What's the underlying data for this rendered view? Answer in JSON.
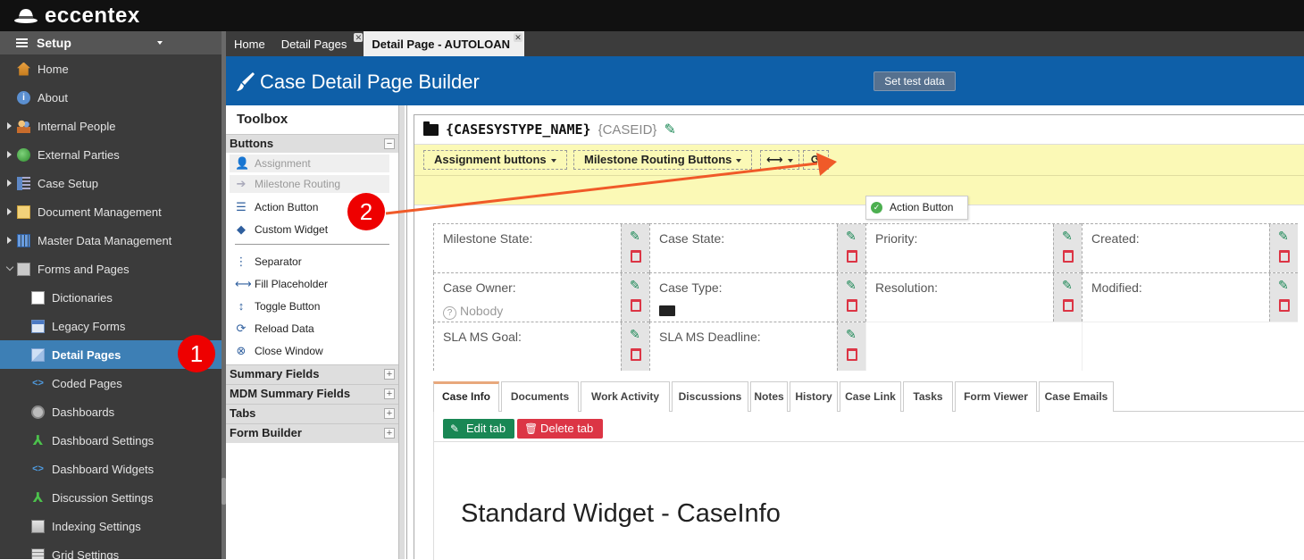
{
  "brand": {
    "name": "eccentex"
  },
  "sidebar": {
    "header": "Setup",
    "items": [
      {
        "label": "Home",
        "icon": "home-icon",
        "level": 1,
        "expander": "none"
      },
      {
        "label": "About",
        "icon": "info-icon",
        "level": 1,
        "expander": "none"
      },
      {
        "label": "Internal People",
        "icon": "people-icon",
        "level": 1,
        "expander": "closed"
      },
      {
        "label": "External Parties",
        "icon": "globe-icon",
        "level": 1,
        "expander": "closed"
      },
      {
        "label": "Case Setup",
        "icon": "case-setup-icon",
        "level": 1,
        "expander": "closed"
      },
      {
        "label": "Document Management",
        "icon": "document-icon",
        "level": 1,
        "expander": "closed"
      },
      {
        "label": "Master Data Management",
        "icon": "grid-icon",
        "level": 1,
        "expander": "closed"
      },
      {
        "label": "Forms and Pages",
        "icon": "forms-icon",
        "level": 1,
        "expander": "open"
      },
      {
        "label": "Dictionaries",
        "icon": "dictionary-icon",
        "level": 2,
        "expander": "none"
      },
      {
        "label": "Legacy Forms",
        "icon": "legacy-form-icon",
        "level": 2,
        "expander": "none"
      },
      {
        "label": "Detail Pages",
        "icon": "detail-page-icon",
        "level": 2,
        "expander": "none",
        "active": true
      },
      {
        "label": "Coded Pages",
        "icon": "code-icon",
        "level": 2,
        "expander": "none"
      },
      {
        "label": "Dashboards",
        "icon": "dashboard-icon",
        "level": 2,
        "expander": "none"
      },
      {
        "label": "Dashboard Settings",
        "icon": "tree-icon",
        "level": 2,
        "expander": "none"
      },
      {
        "label": "Dashboard Widgets",
        "icon": "code-icon",
        "level": 2,
        "expander": "none"
      },
      {
        "label": "Discussion Settings",
        "icon": "tree-icon",
        "level": 2,
        "expander": "none"
      },
      {
        "label": "Indexing Settings",
        "icon": "index-icon",
        "level": 2,
        "expander": "none"
      },
      {
        "label": "Grid Settings",
        "icon": "grid-settings-icon",
        "level": 2,
        "expander": "none"
      }
    ]
  },
  "page_tabs": [
    {
      "label": "Home",
      "closable": false
    },
    {
      "label": "Detail Pages",
      "closable": true
    },
    {
      "label": "Detail Page - AUTOLOAN",
      "closable": true,
      "active": true
    }
  ],
  "header": {
    "title": "Case Detail Page Builder",
    "test_button": "Set test data"
  },
  "toolbox": {
    "title": "Toolbox",
    "buttons_section": "Buttons",
    "button_items": [
      {
        "label": "Assignment",
        "glyph": "👤",
        "icon": "user-icon",
        "disabled": true
      },
      {
        "label": "Milestone Routing",
        "glyph": "➔",
        "icon": "arrow-right-icon",
        "disabled": true
      },
      {
        "label": "Action Button",
        "glyph": "☰",
        "icon": "database-icon",
        "disabled": false
      },
      {
        "label": "Custom Widget",
        "glyph": "◆",
        "icon": "tag-icon",
        "disabled": false
      }
    ],
    "other_items": [
      {
        "label": "Separator",
        "glyph": "⋮",
        "icon": "separator-icon"
      },
      {
        "label": "Fill Placeholder",
        "glyph": "⟷",
        "icon": "fill-placeholder-icon"
      },
      {
        "label": "Toggle Button",
        "glyph": "↕",
        "icon": "toggle-icon"
      },
      {
        "label": "Reload Data",
        "glyph": "⟳",
        "icon": "reload-icon"
      },
      {
        "label": "Close Window",
        "glyph": "⊗",
        "icon": "close-window-icon"
      }
    ],
    "collapsed_sections": [
      "Summary Fields",
      "MDM Summary Fields",
      "Tabs",
      "Form Builder"
    ]
  },
  "case": {
    "name": "{CASESYSTYPE_NAME}",
    "id": "{CASEID}"
  },
  "toolbar": {
    "assignment": "Assignment buttons",
    "milestone": "Milestone Routing Buttons",
    "fill_glyph": "⟷",
    "reload_glyph": "⟳",
    "dropped": "Action Button"
  },
  "fields": [
    {
      "label": "Milestone State:",
      "value": ""
    },
    {
      "label": "Case State:",
      "value": ""
    },
    {
      "label": "Priority:",
      "value": ""
    },
    {
      "label": "Created:",
      "value": ""
    },
    {
      "label": "Case Owner:",
      "value": "Nobody"
    },
    {
      "label": "Case Type:",
      "value": ""
    },
    {
      "label": "Resolution:",
      "value": ""
    },
    {
      "label": "Modified:",
      "value": ""
    },
    {
      "label": "SLA MS Goal:",
      "value": ""
    },
    {
      "label": "SLA MS Deadline:",
      "value": ""
    }
  ],
  "content_tabs": [
    "Case Info",
    "Documents",
    "Work Activity",
    "Discussions",
    "Notes",
    "History",
    "Case Link",
    "Tasks",
    "Form Viewer",
    "Case Emails"
  ],
  "tab_actions": {
    "edit": "Edit tab",
    "delete": "Delete tab"
  },
  "widget_title": "Standard Widget - CaseInfo",
  "annotations": [
    "1",
    "2"
  ],
  "colors": {
    "header": "#0e5fa8",
    "active_nav": "#3d7fb5",
    "toolbar_bg": "#fbf9b6",
    "edit": "#198754",
    "delete": "#dc3545",
    "badge": "#ee0000",
    "arrow": "#f05a28"
  }
}
